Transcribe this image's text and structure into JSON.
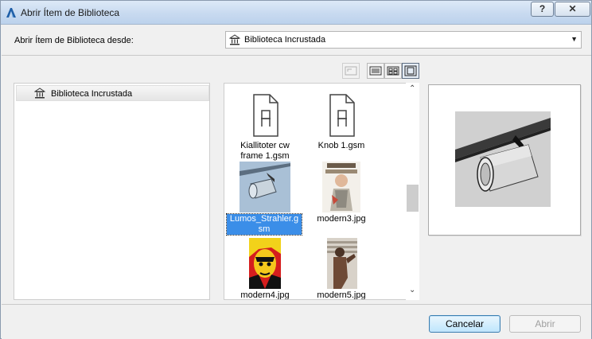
{
  "window": {
    "title": "Abrir Ítem de Biblioteca",
    "help_label": "?",
    "close_label": "✕"
  },
  "source": {
    "label": "Abrir Ítem de Biblioteca desde:",
    "selected": "Biblioteca Incrustada"
  },
  "view_buttons": [
    {
      "name": "folder-up",
      "state": "disabled"
    },
    {
      "name": "list-view",
      "state": "normal"
    },
    {
      "name": "small-icons-view",
      "state": "normal"
    },
    {
      "name": "large-icons-view",
      "state": "active"
    }
  ],
  "tree": {
    "items": [
      {
        "label": "Biblioteca Incrustada",
        "icon": "library-icon"
      }
    ]
  },
  "grid": {
    "items": [
      {
        "caption": "Kiallitoter cw frame 1.gsm",
        "line1": "Kiallitoter cw",
        "line2": "frame 1.gsm",
        "thumb": "gsm-document-icon",
        "selected": false
      },
      {
        "caption": "Knob 1.gsm",
        "line1": "Knob 1.gsm",
        "line2": "",
        "thumb": "gsm-document-icon",
        "selected": false
      },
      {
        "caption": "Lumos_Strahler.gsm",
        "line1": "Lumos_Strahler.g",
        "line2": "sm",
        "thumb": "spotlight-thumbnail",
        "selected": true
      },
      {
        "caption": "modern3.jpg",
        "line1": "modern3.jpg",
        "line2": "",
        "thumb": "collage-thumbnail",
        "selected": false
      },
      {
        "caption": "modern4.jpg",
        "line1": "modern4.jpg",
        "line2": "",
        "thumb": "pop-art-thumbnail",
        "selected": false
      },
      {
        "caption": "modern5.jpg",
        "line1": "modern5.jpg",
        "line2": "",
        "thumb": "figure-thumbnail",
        "selected": false
      }
    ]
  },
  "buttons": {
    "cancel": "Cancelar",
    "open": "Abrir"
  },
  "colors": {
    "selection": "#3b8ee8",
    "title_bar": "#c8daf0"
  }
}
